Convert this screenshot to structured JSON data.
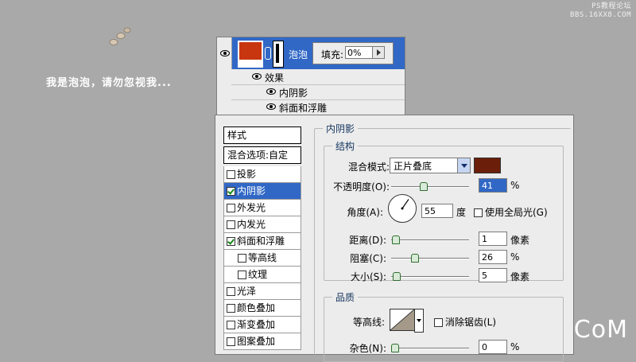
{
  "canvas": {
    "watermark_line1": "PS教程论坛",
    "watermark_line2": "BBS.16XX8.COM",
    "message": "我是泡泡，请勿忽视我...",
    "brand": "UiBQ.CoM"
  },
  "layers_panel": {
    "layer_name": "泡泡",
    "fill_label": "填充:",
    "fill_value": "0%",
    "effects_label": "效果",
    "effects": [
      "内阴影",
      "斜面和浮雕"
    ]
  },
  "dialog": {
    "styles_header": "样式",
    "blend_options": "混合选项:自定",
    "styles": [
      {
        "label": "投影",
        "checked": false,
        "selected": false,
        "sub": false
      },
      {
        "label": "内阴影",
        "checked": true,
        "selected": true,
        "sub": false
      },
      {
        "label": "外发光",
        "checked": false,
        "selected": false,
        "sub": false
      },
      {
        "label": "内发光",
        "checked": false,
        "selected": false,
        "sub": false
      },
      {
        "label": "斜面和浮雕",
        "checked": true,
        "selected": false,
        "sub": false
      },
      {
        "label": "等高线",
        "checked": false,
        "selected": false,
        "sub": true
      },
      {
        "label": "纹理",
        "checked": false,
        "selected": false,
        "sub": true
      },
      {
        "label": "光泽",
        "checked": false,
        "selected": false,
        "sub": false
      },
      {
        "label": "颜色叠加",
        "checked": false,
        "selected": false,
        "sub": false
      },
      {
        "label": "渐变叠加",
        "checked": false,
        "selected": false,
        "sub": false
      },
      {
        "label": "图案叠加",
        "checked": false,
        "selected": false,
        "sub": false
      }
    ],
    "panel_title": "内阴影",
    "structure_title": "结构",
    "blend_mode_label": "混合模式:",
    "blend_mode_value": "正片叠底",
    "shadow_color": "#6b1f0a",
    "opacity_label": "不透明度(O):",
    "opacity_value": "41",
    "opacity_unit": "%",
    "opacity_level": 0.41,
    "angle_label": "角度(A):",
    "angle_value": "55",
    "angle_unit": "度",
    "global_light_label": "使用全局光(G)",
    "distance_label": "距离(D):",
    "distance_value": "1",
    "distance_unit": "像素",
    "choke_label": "阻塞(C):",
    "choke_value": "26",
    "choke_unit": "%",
    "size_label": "大小(S):",
    "size_value": "5",
    "size_unit": "像素",
    "quality_title": "品质",
    "contour_label": "等高线:",
    "antialias_label": "消除锯齿(L)",
    "noise_label": "杂色(N):",
    "noise_value": "0",
    "noise_unit": "%"
  }
}
